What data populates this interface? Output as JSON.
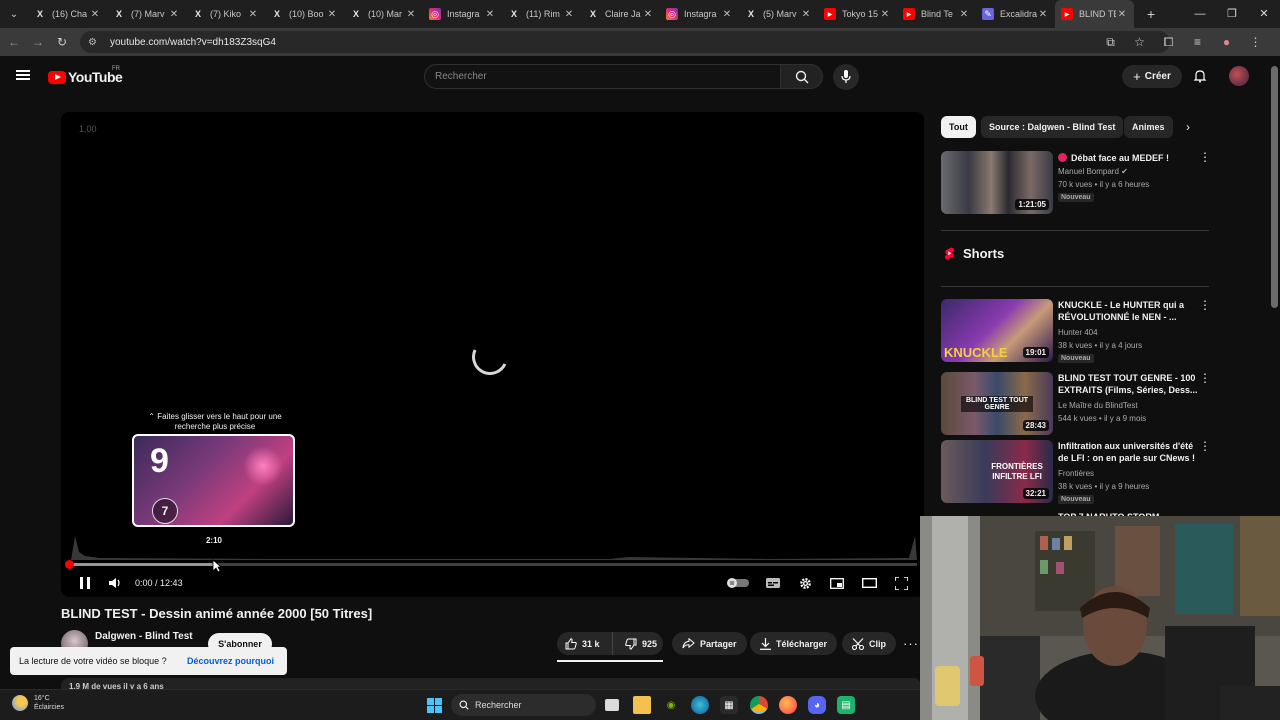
{
  "browser": {
    "tabs": [
      {
        "title": "(16) Cha",
        "icon": "x-icon",
        "active": false
      },
      {
        "title": "(7) Marv",
        "icon": "x-icon",
        "active": false
      },
      {
        "title": "(7) Kiko",
        "icon": "x-icon",
        "active": false
      },
      {
        "title": "(10) Boo",
        "icon": "x-icon",
        "active": false
      },
      {
        "title": "(10) Mar",
        "icon": "x-icon",
        "active": false
      },
      {
        "title": "Instagra",
        "icon": "instagram-icon",
        "active": false
      },
      {
        "title": "(11) Rim",
        "icon": "x-icon",
        "active": false
      },
      {
        "title": "Claire Ja",
        "icon": "x-icon",
        "active": false
      },
      {
        "title": "Instagra",
        "icon": "instagram-icon",
        "active": false
      },
      {
        "title": "(5) Marv",
        "icon": "x-icon",
        "active": false
      },
      {
        "title": "Tokyo 15",
        "icon": "youtube-icon",
        "active": false
      },
      {
        "title": "Blind Te",
        "icon": "youtube-icon",
        "active": false
      },
      {
        "title": "Excalidra",
        "icon": "excalidraw-icon",
        "active": false
      },
      {
        "title": "BLIND TE",
        "icon": "youtube-icon",
        "active": true
      }
    ],
    "new_tab": "+",
    "url": "youtube.com/watch?v=dh183Z3sqG4"
  },
  "header": {
    "logo_text": "YouTube",
    "country_code": "FR",
    "search_placeholder": "Rechercher",
    "create_label": "Créer"
  },
  "player": {
    "speed_readout": "1.00",
    "seek_hint": "⌃ Faites glisser vers le haut pour une recherche plus précise",
    "preview_time": "2:10",
    "preview_number_big": "9",
    "preview_number_small": "7",
    "current_time": "0:00",
    "duration": "12:43",
    "played_fraction": 0.0,
    "buffered_fraction": 0.17,
    "hover_fraction": 0.17
  },
  "video": {
    "title": "BLIND TEST - Dessin animé année 2000 [50 Titres]",
    "channel": "Dalgwen - Blind Test",
    "subscribe_label": "S'abonner",
    "likes": "31 k",
    "dislikes": "925",
    "share_label": "Partager",
    "download_label": "Télécharger",
    "clip_label": "Clip",
    "meta": "1,9 M de vues  il y a 6 ans"
  },
  "toast": {
    "message": "La lecture de votre vidéo se bloque ?",
    "link": "Découvrez pourquoi"
  },
  "sidebar": {
    "chips": [
      "Tout",
      "Source : Dalgwen - Blind Test",
      "Animes"
    ],
    "first_rec": {
      "title": "Débat face au MEDEF !",
      "channel": "Manuel Bompard",
      "stats": "70 k vues • il y a 6 heures",
      "badge": "Nouveau",
      "duration": "1:21:05"
    },
    "shorts_label": "Shorts",
    "recs": [
      {
        "title": "KNUCKLE - Le HUNTER qui a RÉVOLUTIONNÉ le NEN - ...",
        "channel": "Hunter 404",
        "stats": "38 k vues • il y a 4 jours",
        "badge": "Nouveau",
        "duration": "19:01",
        "thumb_text": "KNUCKLE"
      },
      {
        "title": "BLIND TEST TOUT GENRE - 100 EXTRAITS (Films, Séries, Dess...",
        "channel": "Le Maître du BlindTest",
        "stats": "544 k vues • il y a 9 mois",
        "badge": "",
        "duration": "28:43",
        "thumb_text": "BLIND TEST TOUT GENRE"
      },
      {
        "title": "Infiltration aux universités d'été de LFI : on en parle sur CNews !",
        "channel": "Frontières",
        "stats": "38 k vues • il y a 9 heures",
        "badge": "Nouveau",
        "duration": "32:21",
        "thumb_text": "FRONTIÈRES INFILTRE LFI"
      }
    ],
    "partial_title": "TOP 7 NARUTO STORM ..."
  },
  "taskbar": {
    "temperature": "16°C",
    "weather": "Éclaircies",
    "search_label": "Rechercher"
  },
  "colors": {
    "youtube_red": "#ff0000",
    "background": "#0f0f0f",
    "link_blue": "#065fd4"
  }
}
